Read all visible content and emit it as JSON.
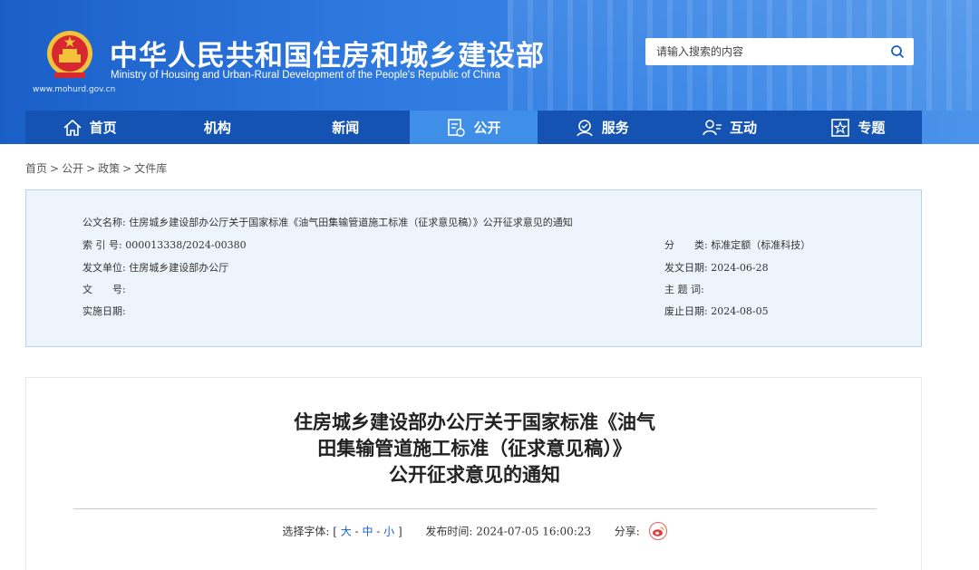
{
  "header": {
    "site_url": "www.mohurd.gov.cn",
    "title_cn": "中华人民共和国住房和城乡建设部",
    "title_en": "Ministry of Housing and Urban-Rural Development of the People's Republic of China",
    "search_placeholder": "请输入搜索的内容",
    "search_icon": "search-icon"
  },
  "nav": {
    "items": [
      {
        "label": "首页",
        "icon": "home-icon"
      },
      {
        "label": "机构",
        "icon": ""
      },
      {
        "label": "新闻",
        "icon": ""
      },
      {
        "label": "公开",
        "icon": "document-icon",
        "active": true
      },
      {
        "label": "服务",
        "icon": "service-icon"
      },
      {
        "label": "互动",
        "icon": "interaction-icon"
      },
      {
        "label": "专题",
        "icon": "star-icon"
      }
    ]
  },
  "breadcrumb": [
    "首页",
    "公开",
    "政策",
    "文件库"
  ],
  "info": {
    "doc_name_label": "公文名称:",
    "doc_name": "住房城乡建设部办公厅关于国家标准《油气田集输管道施工标准（征求意见稿）》公开征求意见的通知",
    "index_label": "索 引 号:",
    "index": "000013338/2024-00380",
    "category_label": "分　　类:",
    "category": "标准定额（标准科技）",
    "issuer_label": "发文单位:",
    "issuer": "住房城乡建设部办公厅",
    "date_label": "发文日期:",
    "date": "2024-06-28",
    "docno_label": "文　　号:",
    "docno": "",
    "subject_label": "主 题 词:",
    "subject": "",
    "effective_label": "实施日期:",
    "effective": "",
    "expiry_label": "废止日期:",
    "expiry": "2024-08-05"
  },
  "article": {
    "title_line1": "住房城乡建设部办公厅关于国家标准《油气",
    "title_line2": "田集输管道施工标准（征求意见稿）》",
    "title_line3": "公开征求意见的通知",
    "font_label": "选择字体:",
    "font_bracket_open": "[",
    "font_large": "大",
    "font_sep1": "-",
    "font_medium": "中",
    "font_sep2": "-",
    "font_small": "小",
    "font_bracket_close": "]",
    "publish_label": "发布时间:",
    "publish_time": "2024-07-05 16:00:23",
    "share_label": "分享:"
  },
  "colors": {
    "header_blue": "#2f7ae0",
    "nav_blue": "#1553b3",
    "nav_active": "#3f8fe8",
    "info_bg": "#eef4fc"
  }
}
